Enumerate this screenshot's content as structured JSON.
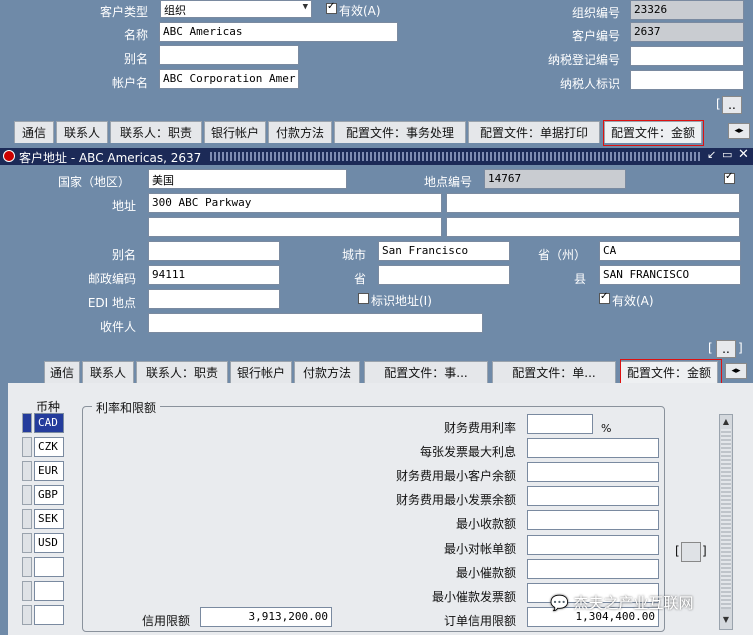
{
  "customer": {
    "type_label": "客户类型",
    "type_value": "组织",
    "active_label": "有效(A)",
    "name_label": "名称",
    "name_value": "ABC Americas",
    "alias_label": "别名",
    "account_label": "帐户名",
    "account_value": "ABC Corporation Amer",
    "org_no_label": "组织编号",
    "org_no_value": "23326",
    "cust_no_label": "客户编号",
    "cust_no_value": "2637",
    "tax_reg_label": "纳税登记编号",
    "taxpayer_label": "纳税人标识",
    "more_label": "[..]"
  },
  "top_tabs": [
    "通信",
    "联系人",
    "联系人：职责",
    "银行帐户",
    "付款方法",
    "配置文件：事务处理",
    "配置文件：单据打印",
    "配置文件：金额"
  ],
  "address_window": {
    "title": "客户地址 - ABC Americas, 2637",
    "country_label": "国家（地区）",
    "country_value": "美国",
    "site_no_label": "地点编号",
    "site_no_value": "14767",
    "address_label": "地址",
    "address_value": "300 ABC Parkway",
    "alias_label": "别名",
    "city_label": "城市",
    "city_value": "San Francisco",
    "state_label": "省（州）",
    "state_value": "CA",
    "postal_label": "邮政编码",
    "postal_value": "94111",
    "province_label": "省",
    "county_label": "县",
    "county_value": "SAN FRANCISCO",
    "edi_label": "EDI 地点",
    "identify_label": "标识地址(I)",
    "active_label": "有效(A)",
    "receiver_label": "收件人",
    "more_label": "[..]"
  },
  "bottom_tabs": [
    "通信",
    "联系人",
    "联系人：职责",
    "银行帐户",
    "付款方法",
    "配置文件：事...",
    "配置文件：单...",
    "配置文件：金额"
  ],
  "amounts": {
    "currency_header": "币种",
    "currencies": [
      "CAD",
      "CZK",
      "EUR",
      "GBP",
      "SEK",
      "USD"
    ],
    "group_title": "利率和限额",
    "fields": [
      {
        "label": "财务费用利率",
        "value": "",
        "suffix": "%"
      },
      {
        "label": "每张发票最大利息",
        "value": ""
      },
      {
        "label": "财务费用最小客户余额",
        "value": ""
      },
      {
        "label": "财务费用最小发票余额",
        "value": ""
      },
      {
        "label": "最小收款额",
        "value": ""
      },
      {
        "label": "最小对帐单额",
        "value": ""
      },
      {
        "label": "最小催款额",
        "value": ""
      },
      {
        "label": "最小催款发票额",
        "value": ""
      },
      {
        "label": "订单信用限额",
        "value": "1,304,400.00"
      }
    ],
    "credit_limit_label": "信用限额",
    "credit_limit_value": "3,913,200.00",
    "side_button": "[ ]"
  },
  "watermark": "杰夫之产业互联网",
  "colors": {
    "background": "#6f8aa8",
    "selected": "#243c9c",
    "highlight": "#dd1111"
  }
}
